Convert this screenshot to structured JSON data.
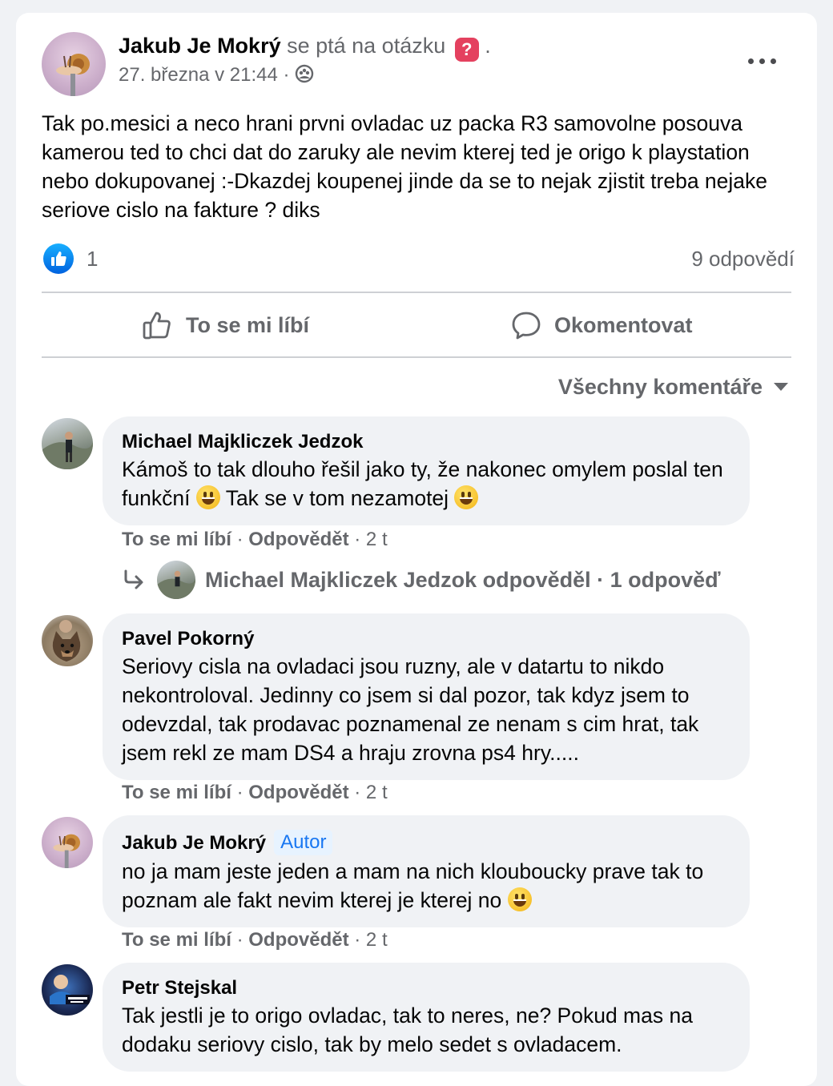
{
  "post": {
    "author_name": "Jakub Je Mokrý",
    "author_suffix": " se ptá na otázku",
    "question_badge": "?",
    "author_trail": " .",
    "date": "27. března v 21:44",
    "meta_sep": " · ",
    "audience_icon": "group-icon",
    "more_icon": "more-dots-icon",
    "body": "Tak po.mesici a neco hrani prvni ovladac uz packa R3 samovolne posouva kamerou ted to chci dat do zaruky ale nevim kterej ted je origo k playstation nebo dokupovanej :-Dkazdej koupenej jinde da se to nejak zjistit treba nejake seriove cislo na fakture ? diks",
    "reaction_count": "1",
    "reply_count": "9 odpovědí"
  },
  "actions": {
    "like": "To se mi líbí",
    "comment": "Okomentovat"
  },
  "sort_label": "Všechny komentáře",
  "comments": [
    {
      "name": "Michael Majkliczek Jedzok",
      "text_a": "Kámoš to tak dlouho řešil jako ty, že nakonec omylem poslal ten funkční ",
      "text_b": " Tak se v tom nezamotej ",
      "like": "To se mi líbí",
      "reply": "Odpovědět",
      "sep": " · ",
      "time": "2 t"
    },
    {
      "name": "Pavel Pokorný",
      "text": "Seriovy cisla na ovladaci jsou ruzny, ale v datartu to nikdo nekontroloval. Jedinny co jsem si dal pozor, tak kdyz jsem to odevzdal, tak prodavac poznamenal ze nenam s cim hrat, tak jsem rekl ze mam DS4 a hraju zrovna ps4 hry.....",
      "like": "To se mi líbí",
      "reply": "Odpovědět",
      "sep": " · ",
      "time": "2 t"
    },
    {
      "name": "Jakub Je Mokrý",
      "badge": "Autor",
      "text": "no ja mam jeste jeden a mam na nich klouboucky prave tak to poznam ale fakt nevim kterej je kterej no ",
      "like": "To se mi líbí",
      "reply": "Odpovědět",
      "sep": " · ",
      "time": "2 t"
    },
    {
      "name": "Petr Stejskal",
      "text": "Tak jestli je to origo ovladac, tak to neres, ne? Pokud mas na dodaku seriovy cislo, tak by melo sedet s ovladacem."
    }
  ],
  "reply_summary": "Michael Majkliczek Jedzok odpověděl · 1 odpověď",
  "colors": {
    "accent": "#1877f2",
    "secondary_text": "#65676b",
    "bubble_bg": "#f0f2f5",
    "question_badge": "#e4415f"
  }
}
